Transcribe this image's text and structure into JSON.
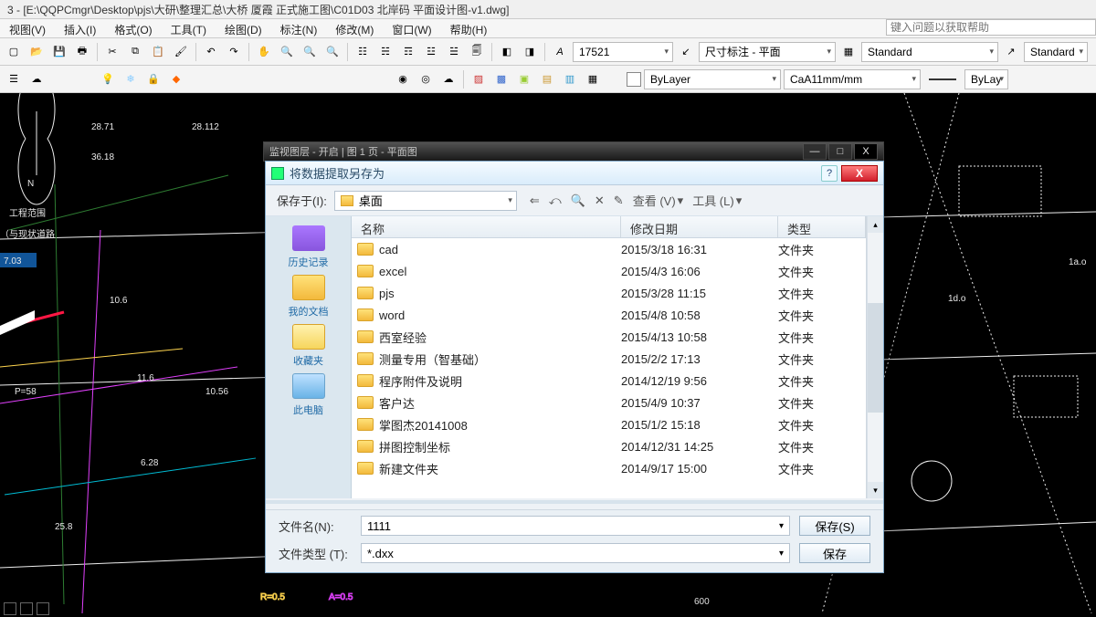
{
  "title": "3 - [E:\\QQPCmgr\\Desktop\\pjs\\大研\\整理汇总\\大桥 厦霞 正式施工图\\C01D03 北岸码 平面设计图-v1.dwg]",
  "help_placeholder": "键入问题以获取帮助",
  "menu": [
    "视图(V)",
    "插入(I)",
    "格式(O)",
    "工具(T)",
    "绘图(D)",
    "标注(N)",
    "修改(M)",
    "窗口(W)",
    "帮助(H)"
  ],
  "combos": {
    "text_size": "17521",
    "dim_style": "尺寸标注 - 平面",
    "std1": "Standard",
    "std2": "Standard",
    "layer": "ByLayer",
    "colorname": "CaA11mm/mm",
    "linetype": "ByLay"
  },
  "subwin": {
    "title": "监视图层 - 开启 | 图 1 页 - 平面图",
    "btn_min": "—",
    "btn_max": "□",
    "btn_close": "X"
  },
  "dialog": {
    "title": "将数据提取另存为",
    "help_btn": "?",
    "close_btn": "X",
    "save_in_label": "保存于(I):",
    "location": "桌面",
    "nav_icons": [
      "⇐",
      "⤺",
      "🔍",
      "✕",
      "✎"
    ],
    "view_label": "查看 (V)",
    "tools_label": "工具 (L)",
    "arrow": "▾",
    "cols": {
      "name": "名称",
      "date": "修改日期",
      "type": "类型"
    },
    "places": [
      {
        "cls": "p-recent",
        "label": "历史记录"
      },
      {
        "cls": "p-docs",
        "label": "我的文档"
      },
      {
        "cls": "p-fav",
        "label": "收藏夹"
      },
      {
        "cls": "p-pc",
        "label": "此电脑"
      }
    ],
    "rows": [
      {
        "name": "cad",
        "date": "2015/3/18 16:31",
        "type": "文件夹"
      },
      {
        "name": "excel",
        "date": "2015/4/3 16:06",
        "type": "文件夹"
      },
      {
        "name": "pjs",
        "date": "2015/3/28 11:15",
        "type": "文件夹"
      },
      {
        "name": "word",
        "date": "2015/4/8 10:58",
        "type": "文件夹"
      },
      {
        "name": "西室经验",
        "date": "2015/4/13 10:58",
        "type": "文件夹"
      },
      {
        "name": "测量专用（智基础）",
        "date": "2015/2/2 17:13",
        "type": "文件夹"
      },
      {
        "name": "程序附件及说明",
        "date": "2014/12/19 9:56",
        "type": "文件夹"
      },
      {
        "name": "客户达",
        "date": "2015/4/9 10:37",
        "type": "文件夹"
      },
      {
        "name": "掌图杰20141008",
        "date": "2015/1/2 15:18",
        "type": "文件夹"
      },
      {
        "name": "拼图控制坐标",
        "date": "2014/12/31 14:25",
        "type": "文件夹"
      },
      {
        "name": "新建文件夹",
        "date": "2014/9/17 15:00",
        "type": "文件夹"
      }
    ],
    "filename_label": "文件名(N):",
    "filetype_label": "文件类型 (T):",
    "filename_value": "1111",
    "filetype_value": "*.dxx",
    "btn_save": "保存(S)",
    "btn_save2": "保存"
  },
  "cad_labels": {
    "proj": "工程范围",
    "road": "（与现状道路"
  }
}
